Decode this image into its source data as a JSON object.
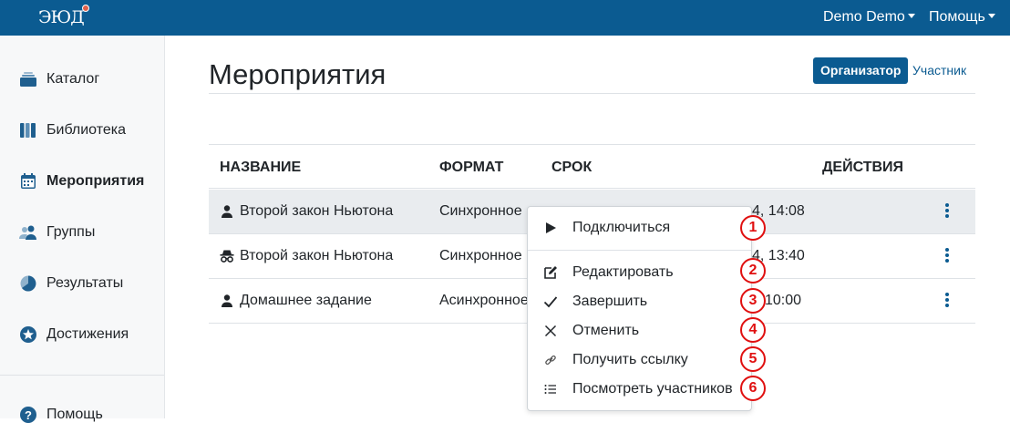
{
  "header": {
    "logo_text": "ЭЮД",
    "user_menu": "Demo Demo",
    "help_menu": "Помощь"
  },
  "sidebar": {
    "items": [
      {
        "label": "Каталог",
        "icon": "catalog-icon"
      },
      {
        "label": "Библиотека",
        "icon": "library-icon"
      },
      {
        "label": "Мероприятия",
        "icon": "calendar-icon",
        "active": true
      },
      {
        "label": "Группы",
        "icon": "users-icon"
      },
      {
        "label": "Результаты",
        "icon": "pie-chart-icon"
      },
      {
        "label": "Достижения",
        "icon": "star-icon"
      }
    ],
    "help": {
      "label": "Помощь",
      "icon": "question-icon"
    }
  },
  "main": {
    "title": "Мероприятия",
    "roles": {
      "organizer": "Организатор",
      "participant": "Участник"
    },
    "table": {
      "headers": {
        "name": "НАЗВАНИЕ",
        "format": "ФОРМАТ",
        "deadline": "СРОК",
        "actions": "ДЕЙСТВИЯ"
      },
      "rows": [
        {
          "icon": "person-icon",
          "name": "Второй закон Ньютона",
          "format": "Синхронное",
          "deadline_tail": "4, 14:08"
        },
        {
          "icon": "incognito-icon",
          "name": "Второй закон Ньютона",
          "format": "Синхронное",
          "deadline_tail": "4, 13:40"
        },
        {
          "icon": "person-icon",
          "name": "Домашнее задание",
          "format": "Асинхронное",
          "deadline_tail": "10:00"
        }
      ]
    }
  },
  "menu": {
    "items": [
      {
        "label": "Подключиться",
        "icon": "play-icon",
        "badge": "1"
      },
      {
        "label": "Редактировать",
        "icon": "edit-icon",
        "badge": "2"
      },
      {
        "label": "Завершить",
        "icon": "check-icon",
        "badge": "3"
      },
      {
        "label": "Отменить",
        "icon": "x-icon",
        "badge": "4"
      },
      {
        "label": "Получить ссылку",
        "icon": "link-icon",
        "badge": "5"
      },
      {
        "label": "Посмотреть участников",
        "icon": "list-icon",
        "badge": "6"
      }
    ]
  },
  "colors": {
    "brand": "#0b5b91",
    "badge": "#e01010",
    "highlight_row": "#e9ecef"
  }
}
